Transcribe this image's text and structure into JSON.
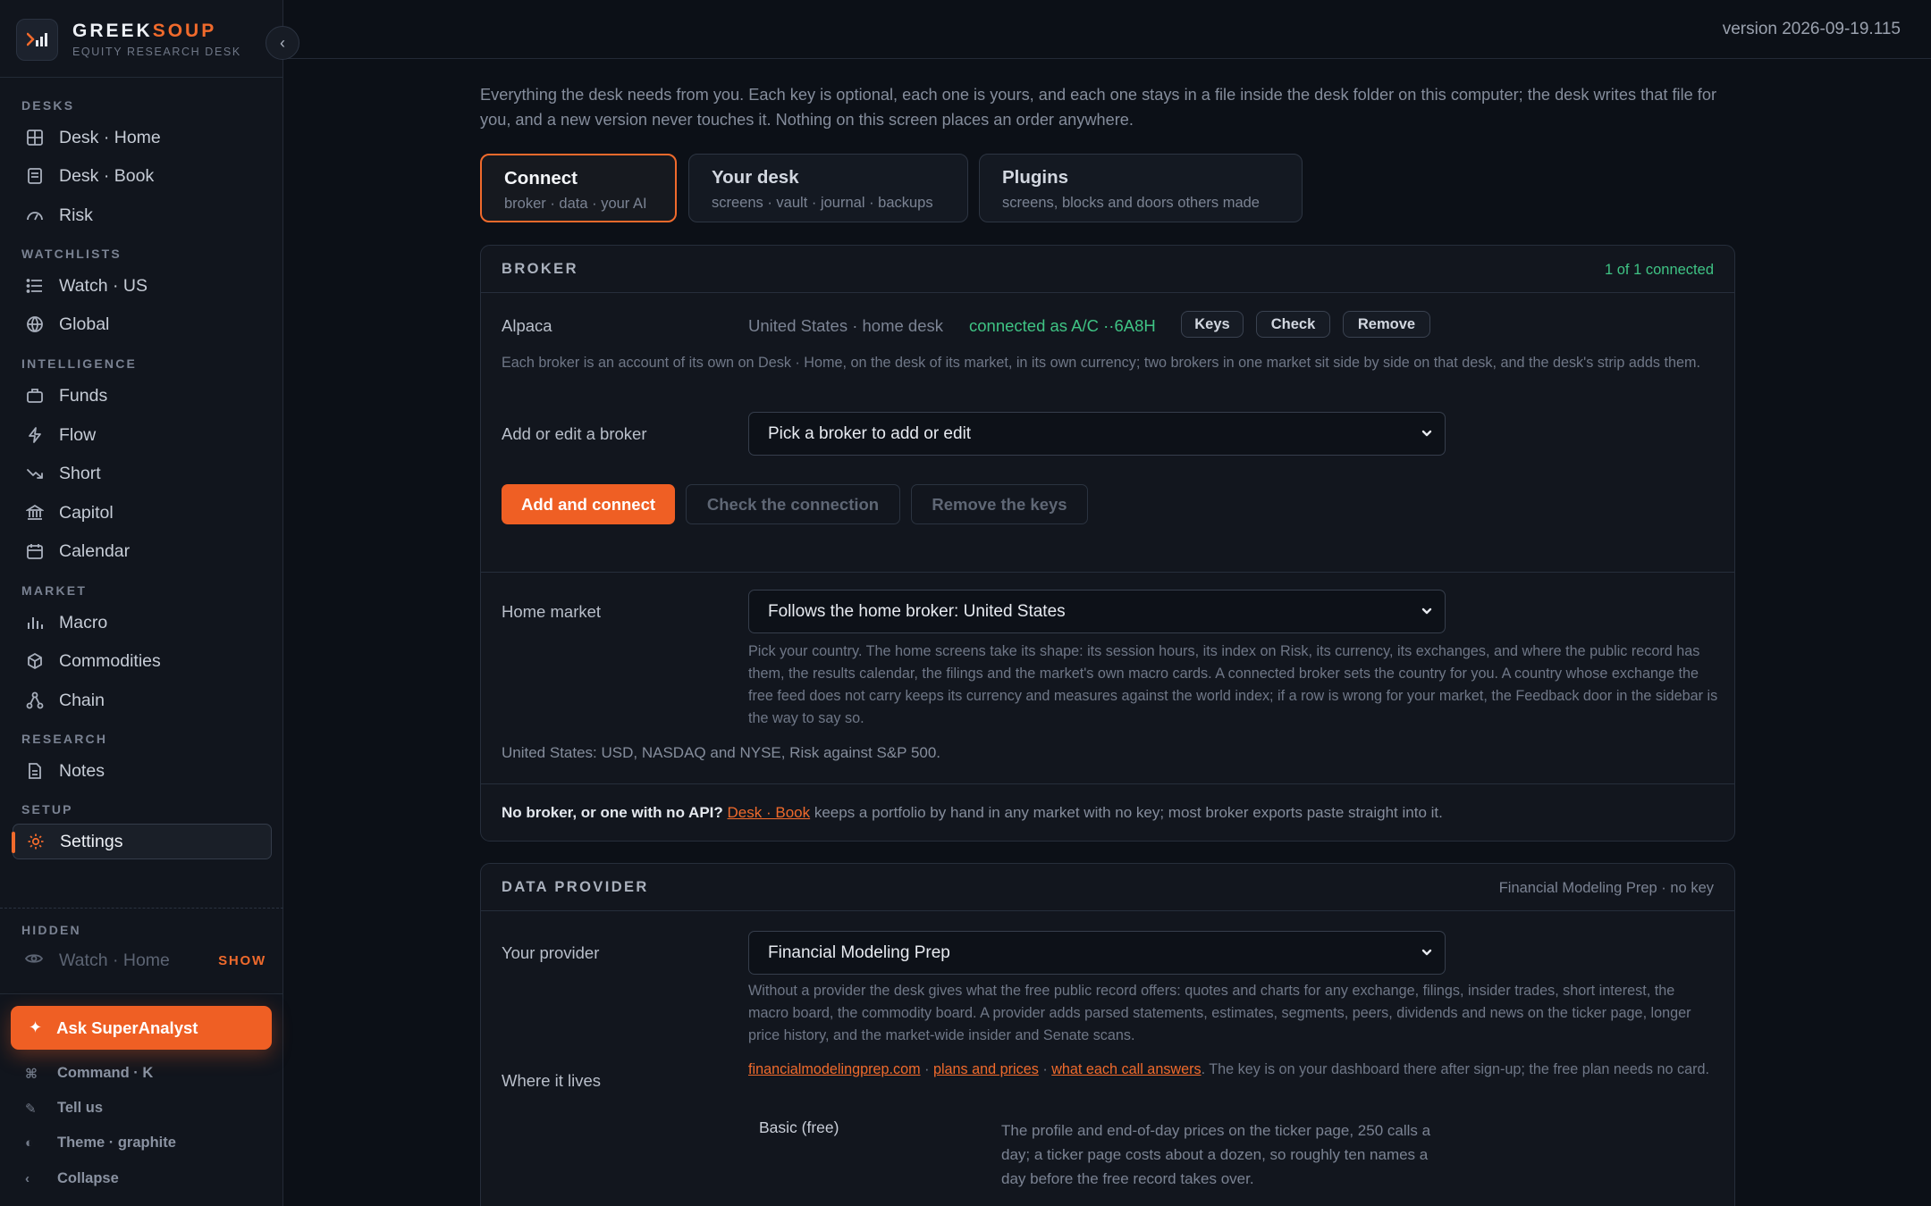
{
  "brand": {
    "name_a": "GREEK",
    "name_b": "SOUP",
    "subtitle": "EQUITY RESEARCH DESK"
  },
  "version": "version 2026-09-19.115",
  "sidebar": {
    "sections": {
      "desks": "DESKS",
      "watchlists": "WATCHLISTS",
      "intelligence": "INTELLIGENCE",
      "market": "MARKET",
      "research": "RESEARCH",
      "setup": "SETUP",
      "hidden": "HIDDEN"
    },
    "items": {
      "desk_home": "Desk · Home",
      "desk_book": "Desk · Book",
      "risk": "Risk",
      "watch_us": "Watch · US",
      "global": "Global",
      "funds": "Funds",
      "flow": "Flow",
      "short": "Short",
      "capitol": "Capitol",
      "calendar": "Calendar",
      "macro": "Macro",
      "commodities": "Commodities",
      "chain": "Chain",
      "notes": "Notes",
      "settings": "Settings"
    },
    "hidden_item": "Watch · Home",
    "show_label": "SHOW",
    "ask": "Ask SuperAnalyst",
    "footer": {
      "command": "Command · K",
      "tell_us": "Tell us",
      "theme": "Theme · graphite",
      "collapse": "Collapse"
    }
  },
  "intro": "Everything the desk needs from you. Each key is optional, each one is yours, and each one stays in a file inside the desk folder on this computer; the desk writes that file for you, and a new version never touches it. Nothing on this screen places an order anywhere.",
  "tabs": [
    {
      "title": "Connect",
      "sub": "broker · data · your AI"
    },
    {
      "title": "Your desk",
      "sub": "screens · vault · journal · backups"
    },
    {
      "title": "Plugins",
      "sub": "screens, blocks and doors others made"
    }
  ],
  "broker": {
    "title": "BROKER",
    "status": "1 of 1 connected",
    "name": "Alpaca",
    "region": "United States · home desk",
    "connected": "connected as A/C ··6A8H",
    "chips": {
      "keys": "Keys",
      "check": "Check",
      "remove": "Remove"
    },
    "note": "Each broker is an account of its own on Desk · Home, on the desk of its market, in its own currency; two brokers in one market sit side by side on that desk, and the desk's strip adds them.",
    "add_label": "Add or edit a broker",
    "add_select": "Pick a broker to add or edit",
    "buttons": {
      "add": "Add and connect",
      "check": "Check the connection",
      "remove": "Remove the keys"
    },
    "home_label": "Home market",
    "home_select": "Follows the home broker: United States",
    "home_note": "Pick your country. The home screens take its shape: its session hours, its index on Risk, its currency, its exchanges, and where the public record has them, the results calendar, the filings and the market's own macro cards. A connected broker sets the country for you. A country whose exchange the free feed does not carry keeps its currency and measures against the world index; if a row is wrong for your market, the Feedback door in the sidebar is the way to say so.",
    "home_summary": "United States: USD, NASDAQ and NYSE, Risk against S&P 500.",
    "nobroker_bold": "No broker, or one with no API?",
    "nobroker_link": "Desk · Book",
    "nobroker_rest": "keeps a portfolio by hand in any market with no key; most broker exports paste straight into it."
  },
  "provider": {
    "title": "DATA PROVIDER",
    "status": "Financial Modeling Prep · no key",
    "label": "Your provider",
    "select": "Financial Modeling Prep",
    "note": "Without a provider the desk gives what the free public record offers: quotes and charts for any exchange, filings, insider trades, short interest, the macro board, the commodity board. A provider adds parsed statements, estimates, segments, peers, dividends and news on the ticker page, longer price history, and the market-wide insider and Senate scans.",
    "where_label": "Where it lives",
    "links": {
      "site": "financialmodelingprep.com",
      "plans": "plans and prices",
      "calls": "what each call answers"
    },
    "sep": "·",
    "where_rest": ". The key is on your dashboard there after sign-up; the free plan needs no card.",
    "plan_name": "Basic (free)",
    "plan_desc": "The profile and end-of-day prices on the ticker page, 250 calls a day; a ticker page costs about a dozen, so roughly ten names a day before the free record takes over."
  },
  "colors": {
    "accent": "#f06a2c",
    "connected": "#3fc384",
    "button": "#ef5f24"
  }
}
